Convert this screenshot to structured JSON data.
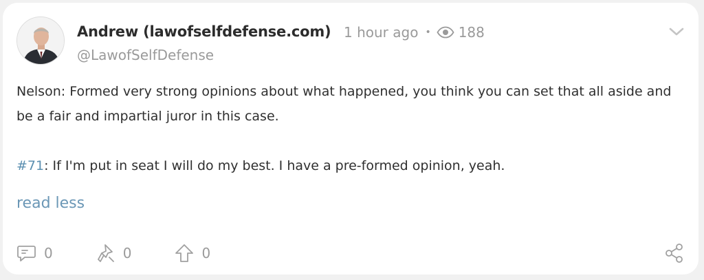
{
  "post": {
    "author_name": "Andrew (lawofselfdefense.com)",
    "handle": "@LawofSelfDefense",
    "time": "1 hour ago",
    "separator": "•",
    "views": "188",
    "body_line1": "Nelson: Formed very strong opinions about what happened, you think you can set that all aside and be a fair and impartial juror in this case.",
    "tag": "#71",
    "body_line2": ": If I'm put in seat I will do my best. I have a pre-formed opinion, yeah.",
    "read_less": "read less"
  },
  "actions": {
    "comments": "0",
    "reposts": "0",
    "upvotes": "0"
  },
  "icons": [
    "eye-icon",
    "chevron-down-icon",
    "comment-icon",
    "repost-icon",
    "upvote-icon",
    "share-icon"
  ],
  "colors": {
    "link": "#6b97b6",
    "muted": "#9a9a9a",
    "text": "#2f2f2f"
  }
}
